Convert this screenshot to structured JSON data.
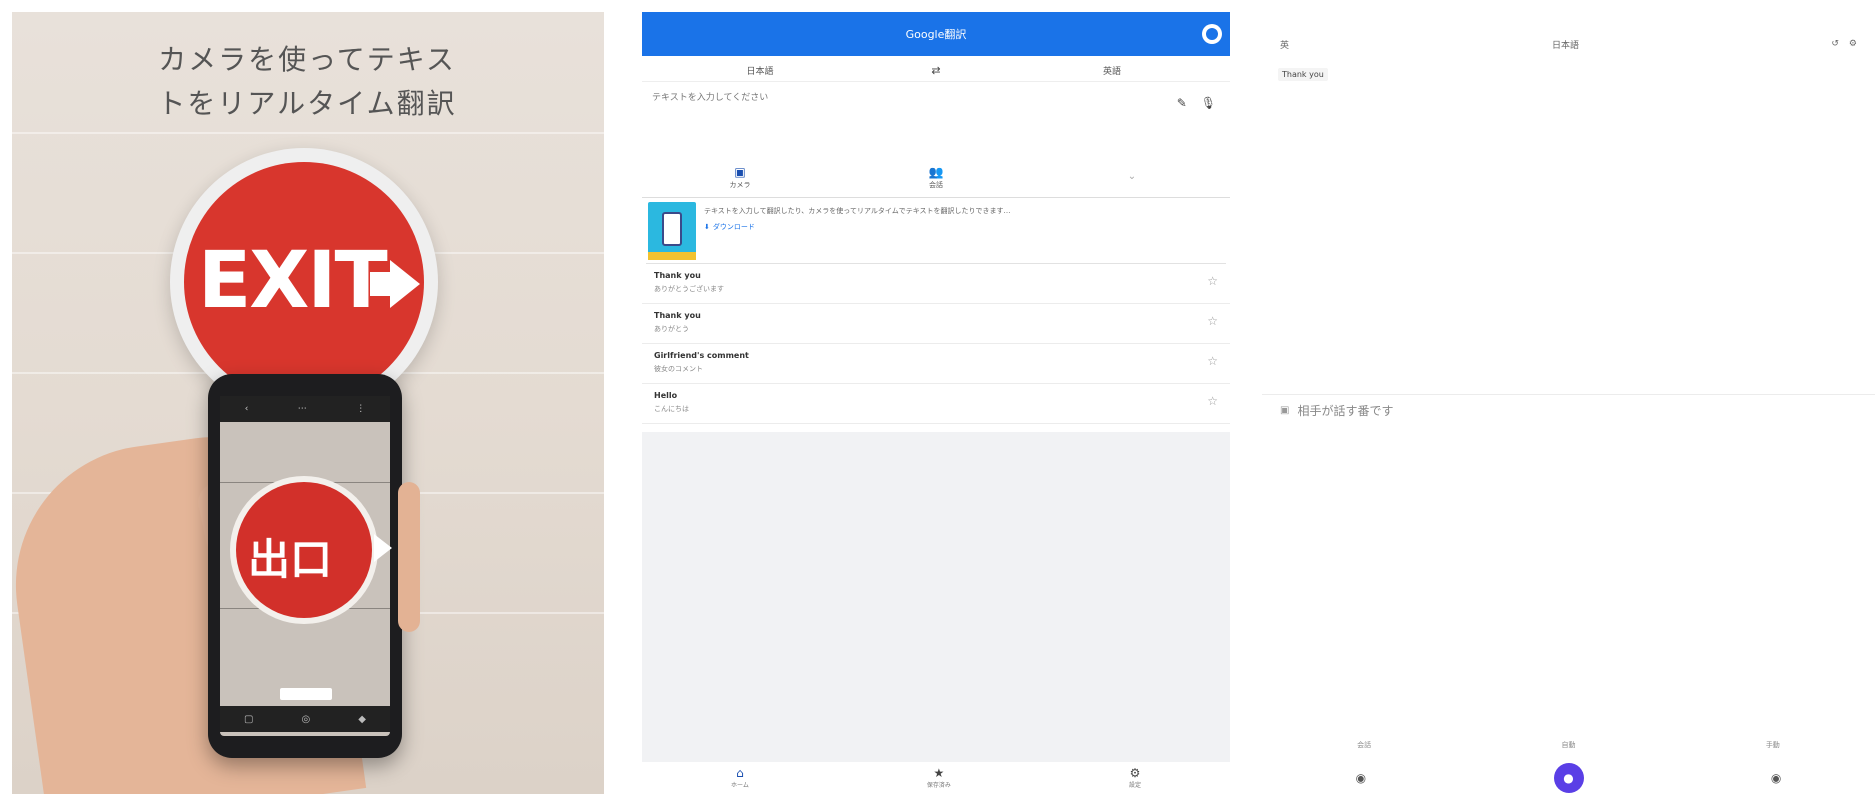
{
  "promo": {
    "title": "カメラを使ってテキス\nトをリアルタイム翻訳",
    "sign_text": "EXIT",
    "screen_text": "出口",
    "screen_chip": "",
    "colors": {
      "sign": "#d8362d",
      "background": "#e4dbd2"
    }
  },
  "app": {
    "header_title": "Google翻訳",
    "accent_color": "#1a73e8",
    "lang_source": "日本語",
    "swap_icon": "swap-icon",
    "lang_target": "英語",
    "input_placeholder": "テキストを入力してください",
    "input_icons": [
      "pen-icon",
      "mic-icon"
    ],
    "modes": [
      {
        "icon": "camera-icon",
        "label": "カメラ"
      },
      {
        "icon": "conversation-icon",
        "label": "会話"
      },
      {
        "icon": "more-icon",
        "label": ""
      }
    ],
    "banner": {
      "text": "テキストを入力して翻訳したり、カメラを使ってリアルタイムでテキストを翻訳したりできます…",
      "download_label": "ダウンロード"
    },
    "history": [
      {
        "src": "Thank you",
        "dst": "ありがとうございます"
      },
      {
        "src": "Thank you",
        "dst": "ありがとう"
      },
      {
        "src": "Girlfriend's comment",
        "dst": "彼女のコメント"
      },
      {
        "src": "Hello",
        "dst": "こんにちは"
      }
    ],
    "nav": [
      {
        "icon": "home-icon",
        "label": "ホーム"
      },
      {
        "icon": "star-icon",
        "label": "保存済み"
      },
      {
        "icon": "settings-icon",
        "label": "設定"
      }
    ]
  },
  "trans": {
    "back_label": "英",
    "lang_label": "日本語",
    "top_icons": [
      "history-icon",
      "settings-icon"
    ],
    "source_chip": "Thank you",
    "result": "相手が話す番です",
    "tabs": [
      "会話",
      "自動",
      "手動"
    ],
    "mic_color": "#5a3fe6"
  }
}
